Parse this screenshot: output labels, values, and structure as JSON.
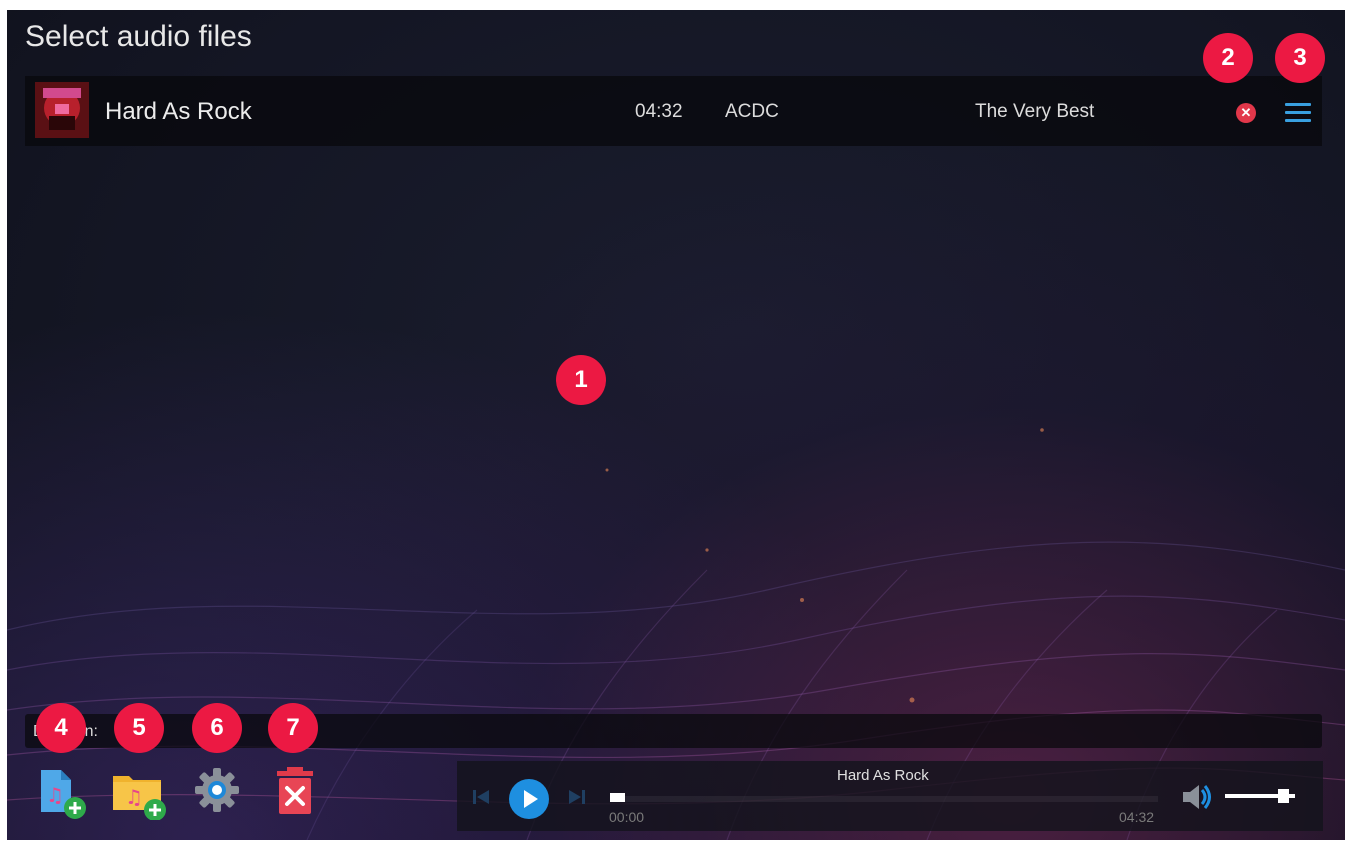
{
  "page": {
    "title": "Select audio files"
  },
  "track": {
    "title": "Hard As Rock",
    "duration": "04:32",
    "artist": "ACDC",
    "album": "The Very Best",
    "remove_icon": "close-circle-icon",
    "menu_icon": "hamburger-menu-icon"
  },
  "info": {
    "duration_label": "Duration:"
  },
  "toolbar": {
    "add_files_icon": "add-music-file-icon",
    "add_folder_icon": "add-music-folder-icon",
    "settings_icon": "gear-icon",
    "clear_icon": "delete-trash-icon"
  },
  "player": {
    "now_playing": "Hard As Rock",
    "current_time": "00:00",
    "total_time": "04:32",
    "progress_fraction": 0,
    "volume_fraction": 0.9
  },
  "markers": [
    "1",
    "2",
    "3",
    "4",
    "5",
    "6",
    "7"
  ],
  "colors": {
    "accent_blue": "#39a0e0",
    "marker_red": "#ec1943",
    "remove_red": "#e2374a"
  }
}
